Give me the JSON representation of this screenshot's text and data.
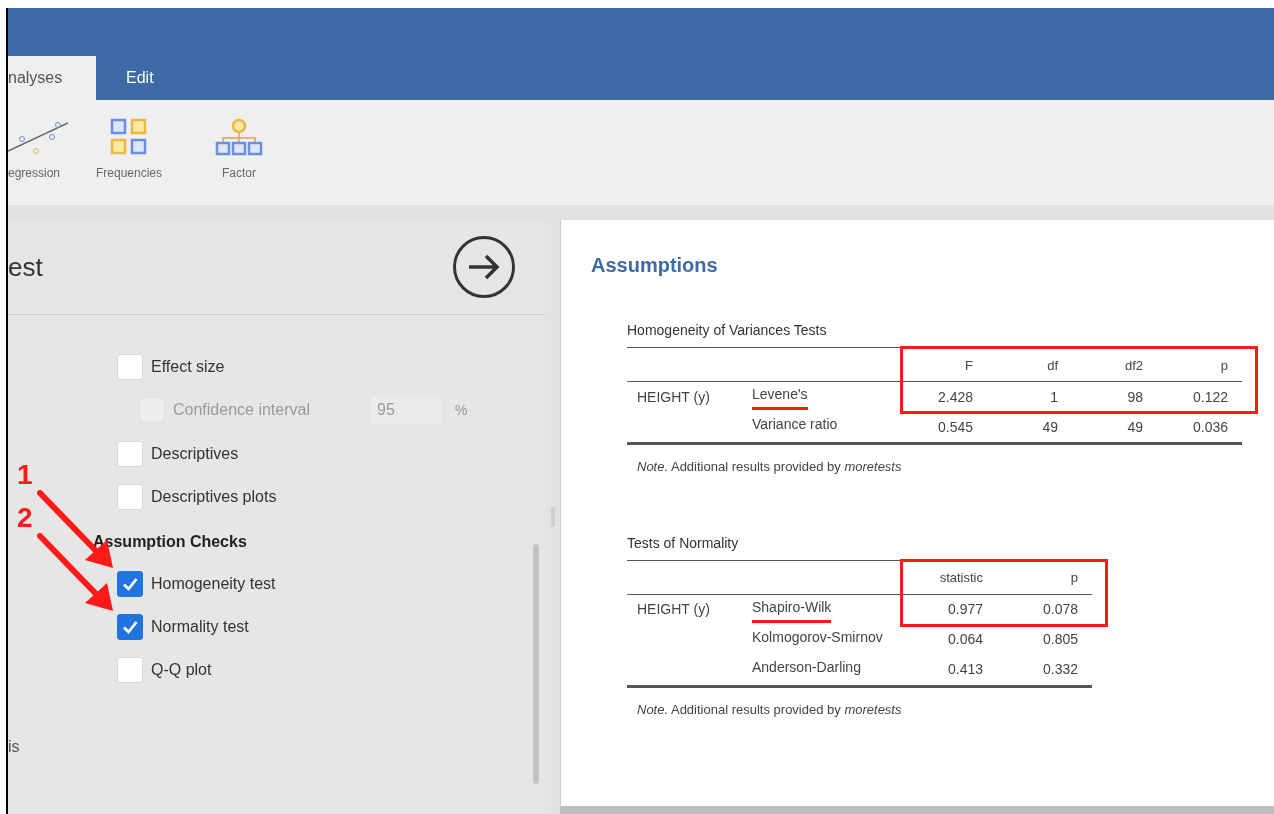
{
  "tabs": [
    {
      "label": "nalyses",
      "selected": true
    },
    {
      "label": "Edit",
      "selected": false
    }
  ],
  "ribbon": [
    {
      "label": "egression",
      "kind": "regression"
    },
    {
      "label": "Frequencies",
      "kind": "frequencies"
    },
    {
      "label": "Factor",
      "kind": "factor"
    }
  ],
  "options_panel": {
    "title": "est",
    "options": [
      {
        "kind": "checkbox",
        "label": "Effect size",
        "checked": false
      },
      {
        "kind": "checkbox_value",
        "label": "Confidence interval",
        "value": "95",
        "unit": "%",
        "checked": false,
        "disabled": true
      },
      {
        "kind": "checkbox",
        "label": "Descriptives",
        "checked": false
      },
      {
        "kind": "checkbox",
        "label": "Descriptives plots",
        "checked": false
      },
      {
        "kind": "heading",
        "label": "Assumption Checks"
      },
      {
        "kind": "checkbox",
        "label": "Homogeneity test",
        "checked": true,
        "marker": "1"
      },
      {
        "kind": "checkbox",
        "label": "Normality test",
        "checked": true,
        "marker": "2"
      },
      {
        "kind": "checkbox",
        "label": "Q-Q plot",
        "checked": false
      }
    ],
    "footer_text": "is"
  },
  "results": {
    "title": "Assumptions",
    "tables": [
      {
        "title": "Homogeneity of Variances Tests",
        "columns": [
          "F",
          "df",
          "df2",
          "p"
        ],
        "highlighted": true,
        "rows": [
          {
            "group": "HEIGHT (y)",
            "test": "Levene's",
            "underlined": true,
            "values": [
              "2.428",
              "1",
              "98",
              "0.122"
            ]
          },
          {
            "group": "",
            "test": "Variance ratio",
            "underlined": false,
            "values": [
              "0.545",
              "49",
              "49",
              "0.036"
            ]
          }
        ],
        "note": "*Note.* Additional results provided by *moretests*"
      },
      {
        "title": "Tests of Normality",
        "columns": [
          "statistic",
          "p"
        ],
        "highlighted": true,
        "rows": [
          {
            "group": "HEIGHT (y)",
            "test": "Shapiro-Wilk",
            "underlined": true,
            "values": [
              "0.977",
              "0.078"
            ]
          },
          {
            "group": "",
            "test": "Kolmogorov-Smirnov",
            "underlined": false,
            "values": [
              "0.064",
              "0.805"
            ]
          },
          {
            "group": "",
            "test": "Anderson-Darling",
            "underlined": false,
            "values": [
              "0.413",
              "0.332"
            ]
          }
        ],
        "note": "*Note.* Additional results provided by *moretests*"
      }
    ]
  }
}
